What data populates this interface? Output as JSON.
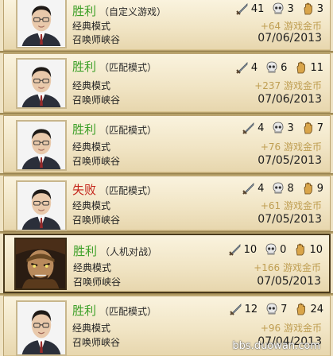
{
  "matches": [
    {
      "result": "胜利",
      "outcome": "win",
      "mode": "（自定义游戏）",
      "kills": "41",
      "deaths": "3",
      "assists": "3",
      "type": "经典模式",
      "reward": "+64 游戏金币",
      "map": "召唤师峡谷",
      "date": "07/06/2013",
      "avatar": "player-portrait"
    },
    {
      "result": "胜利",
      "outcome": "win",
      "mode": "（匹配模式）",
      "kills": "4",
      "deaths": "6",
      "assists": "11",
      "type": "经典模式",
      "reward": "+237 游戏金币",
      "map": "召唤师峡谷",
      "date": "07/06/2013",
      "avatar": "player-portrait"
    },
    {
      "result": "胜利",
      "outcome": "win",
      "mode": "（匹配模式）",
      "kills": "4",
      "deaths": "3",
      "assists": "7",
      "type": "经典模式",
      "reward": "+76 游戏金币",
      "map": "召唤师峡谷",
      "date": "07/05/2013",
      "avatar": "player-portrait"
    },
    {
      "result": "失败",
      "outcome": "loss",
      "mode": "（匹配模式）",
      "kills": "4",
      "deaths": "8",
      "assists": "9",
      "type": "经典模式",
      "reward": "+61 游戏金币",
      "map": "召唤师峡谷",
      "date": "07/05/2013",
      "avatar": "player-portrait"
    },
    {
      "result": "胜利",
      "outcome": "win",
      "mode": "（人机对战）",
      "kills": "10",
      "deaths": "0",
      "assists": "10",
      "type": "经典模式",
      "reward": "+166 游戏金币",
      "map": "召唤师峡谷",
      "date": "07/05/2013",
      "avatar": "champion-portrait"
    },
    {
      "result": "胜利",
      "outcome": "win",
      "mode": "（匹配模式）",
      "kills": "12",
      "deaths": "7",
      "assists": "24",
      "type": "经典模式",
      "reward": "+96 游戏金币",
      "map": "召唤师峡谷",
      "date": "07/04/2013",
      "avatar": "player-portrait"
    }
  ],
  "icons": {
    "kills": "sword-icon",
    "deaths": "skull-icon",
    "assists": "hand-icon"
  },
  "colors": {
    "win": "#3c9f27",
    "loss": "#c4251b",
    "reward": "#bf9e52"
  },
  "watermark": "bbs.duowan.com"
}
